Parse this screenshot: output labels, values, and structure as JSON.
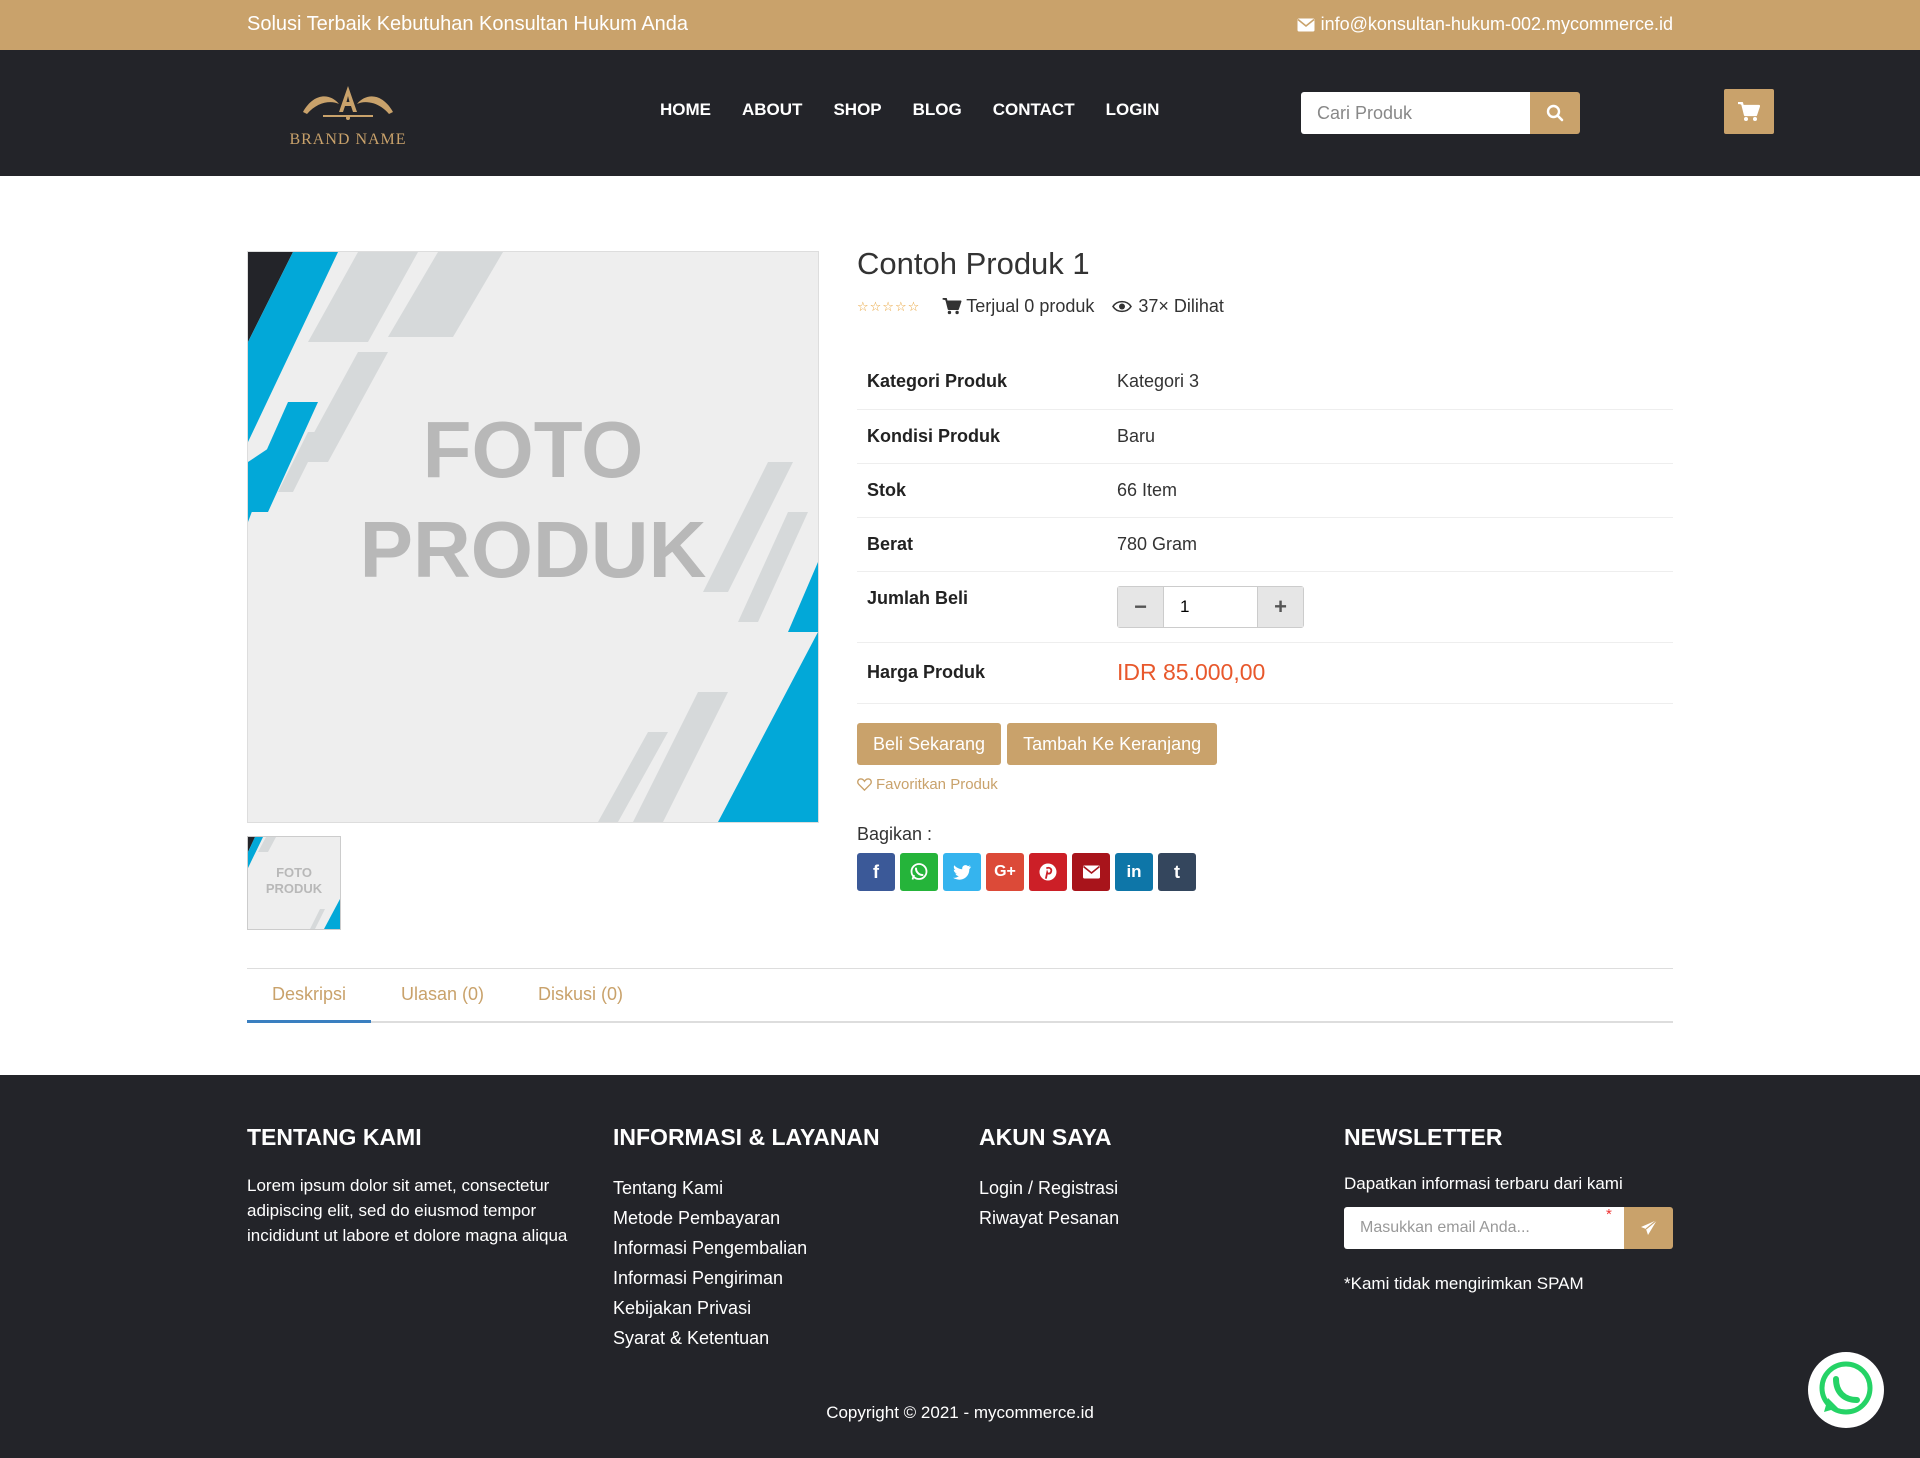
{
  "topbar": {
    "tagline": "Solusi Terbaik Kebutuhan Konsultan Hukum Anda",
    "email": "info@konsultan-hukum-002.mycommerce.id"
  },
  "header": {
    "logo_text": "BRAND NAME",
    "nav": [
      "HOME",
      "ABOUT",
      "SHOP",
      "BLOG",
      "CONTACT",
      "LOGIN"
    ],
    "search_placeholder": "Cari Produk"
  },
  "product": {
    "image_text_line1": "FOTO",
    "image_text_line2": "PRODUK",
    "title": "Contoh Produk 1",
    "rating": 0,
    "sold": "Terjual 0 produk",
    "views": "37× Dilihat",
    "specs": [
      {
        "label": "Kategori Produk",
        "value": "Kategori 3"
      },
      {
        "label": "Kondisi Produk",
        "value": "Baru"
      },
      {
        "label": "Stok",
        "value": "66 Item"
      },
      {
        "label": "Berat",
        "value": "780 Gram"
      }
    ],
    "qty_label": "Jumlah Beli",
    "qty_value": "1",
    "price_label": "Harga Produk",
    "price": "IDR 85.000,00",
    "buy_now": "Beli Sekarang",
    "add_cart": "Tambah Ke Keranjang",
    "favorite": "Favoritkan Produk",
    "share_label": "Bagikan :"
  },
  "tabs": [
    "Deskripsi",
    "Ulasan (0)",
    "Diskusi (0)"
  ],
  "footer": {
    "about_title": "TENTANG KAMI",
    "about_text": "Lorem ipsum dolor sit amet, consectetur adipiscing elit, sed do eiusmod tempor incididunt ut labore et dolore magna aliqua",
    "info_title": "INFORMASI & LAYANAN",
    "info_links": [
      "Tentang Kami",
      "Metode Pembayaran",
      "Informasi Pengembalian",
      "Informasi Pengiriman",
      "Kebijakan Privasi",
      "Syarat & Ketentuan"
    ],
    "account_title": "AKUN SAYA",
    "account_links": [
      "Login / Registrasi",
      "Riwayat Pesanan"
    ],
    "newsletter_title": "NEWSLETTER",
    "newsletter_text": "Dapatkan informasi terbaru dari kami",
    "newsletter_placeholder": "Masukkan email Anda...",
    "newsletter_required": "*",
    "spam_note": "*Kami tidak mengirimkan SPAM",
    "copyright": "Copyright © 2021 - mycommerce.id"
  },
  "colors": {
    "accent": "#c9a26b",
    "dark": "#232429",
    "price": "#e8582c",
    "tab_active": "#3a7fc0"
  },
  "share_buttons": [
    {
      "icon": "facebook-icon",
      "color": "#3b5998"
    },
    {
      "icon": "whatsapp-icon",
      "color": "#25b43a"
    },
    {
      "icon": "twitter-icon",
      "color": "#35b4ee"
    },
    {
      "icon": "google-plus-icon",
      "color": "#dc4a38"
    },
    {
      "icon": "pinterest-icon",
      "color": "#cc1f27"
    },
    {
      "icon": "email-icon",
      "color": "#a8141b"
    },
    {
      "icon": "linkedin-icon",
      "color": "#0e76a8"
    },
    {
      "icon": "tumblr-icon",
      "color": "#34465d"
    }
  ]
}
